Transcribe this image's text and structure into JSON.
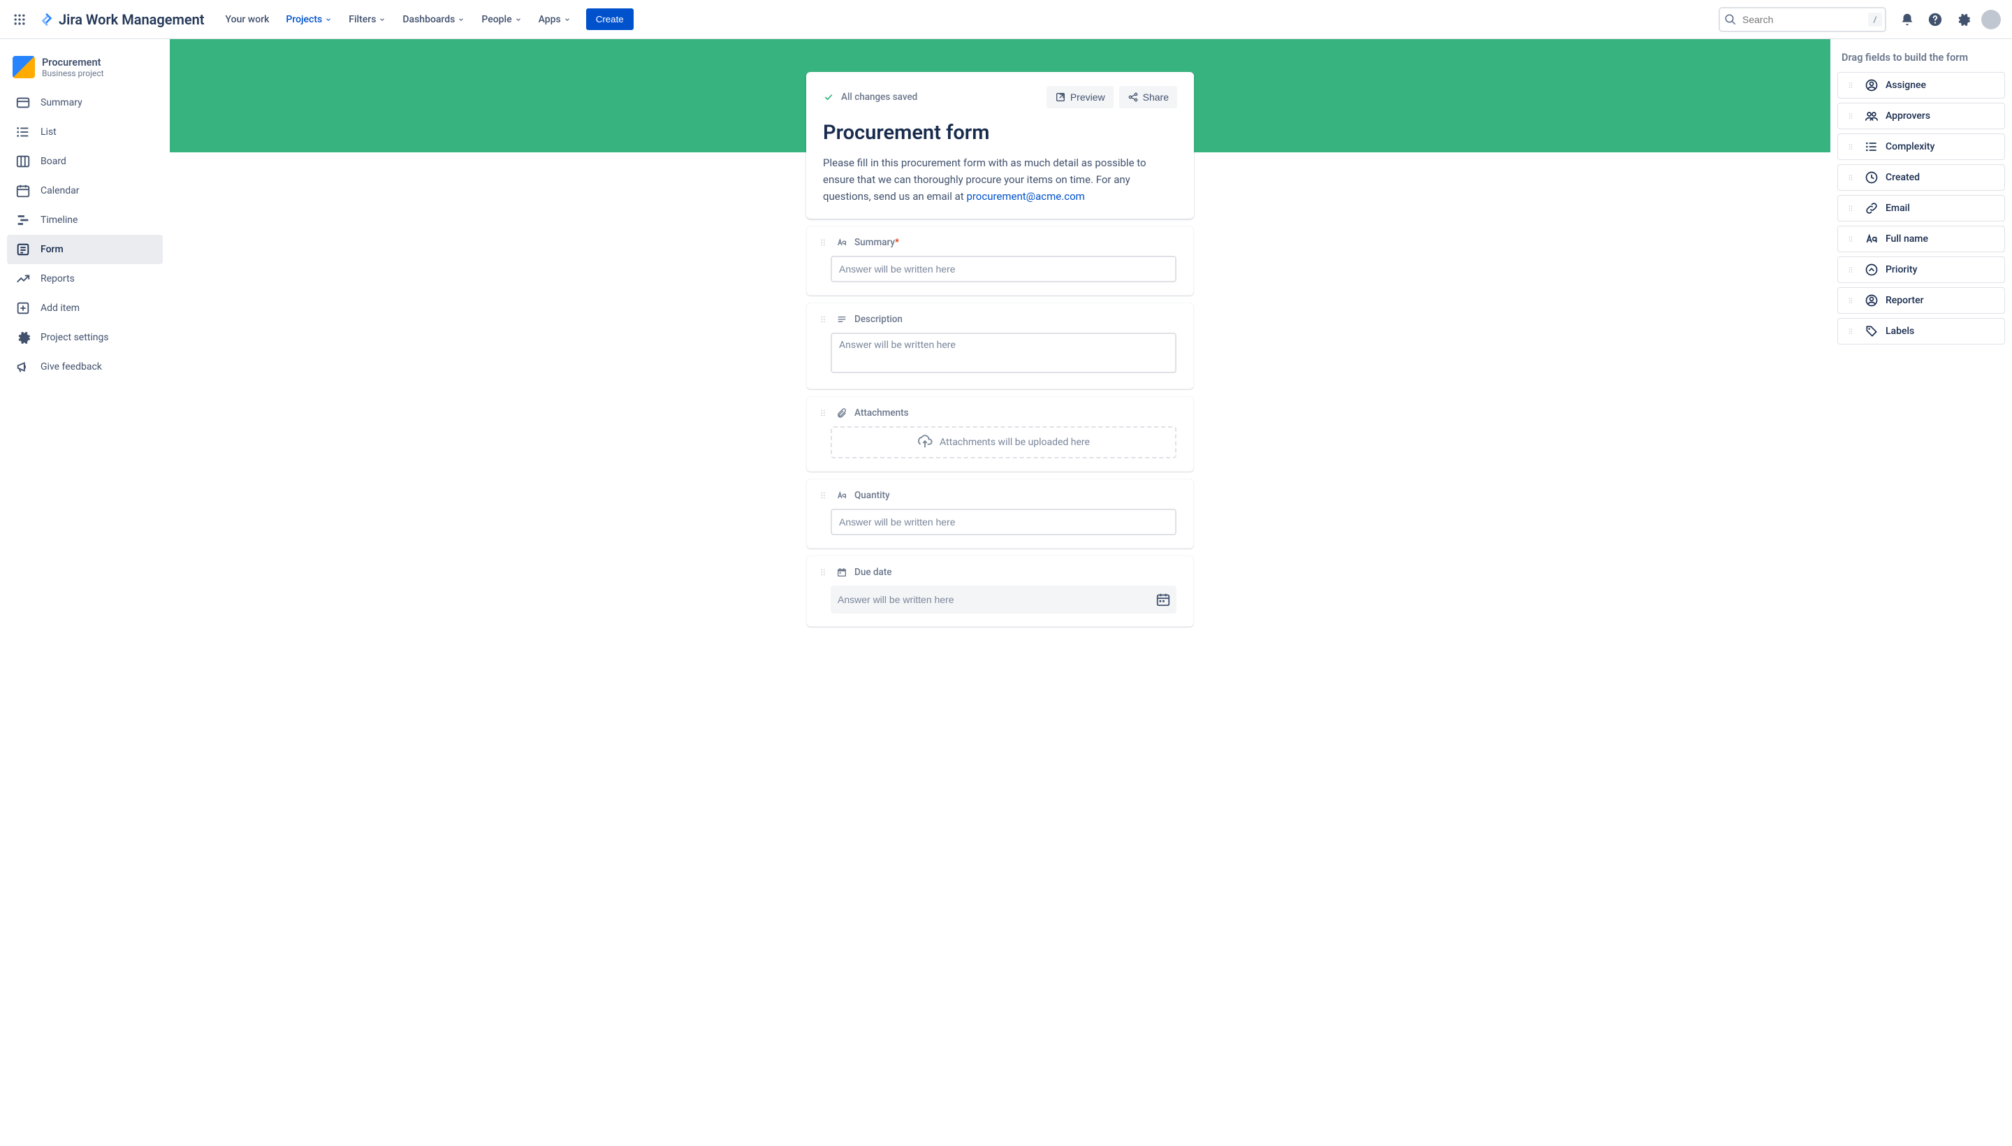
{
  "topnav": {
    "product": "Jira Work Management",
    "items": [
      {
        "label": "Your work",
        "dropdown": false,
        "active": false
      },
      {
        "label": "Projects",
        "dropdown": true,
        "active": true
      },
      {
        "label": "Filters",
        "dropdown": true,
        "active": false
      },
      {
        "label": "Dashboards",
        "dropdown": true,
        "active": false
      },
      {
        "label": "People",
        "dropdown": true,
        "active": false
      },
      {
        "label": "Apps",
        "dropdown": true,
        "active": false
      }
    ],
    "create": "Create",
    "search_placeholder": "Search",
    "slash": "/"
  },
  "project": {
    "name": "Procurement",
    "type": "Business project"
  },
  "sidebar": [
    {
      "icon": "summary",
      "label": "Summary"
    },
    {
      "icon": "list",
      "label": "List"
    },
    {
      "icon": "board",
      "label": "Board"
    },
    {
      "icon": "calendar",
      "label": "Calendar"
    },
    {
      "icon": "timeline",
      "label": "Timeline"
    },
    {
      "icon": "form",
      "label": "Form",
      "selected": true
    },
    {
      "icon": "reports",
      "label": "Reports"
    },
    {
      "icon": "additem",
      "label": "Add item"
    },
    {
      "icon": "settings",
      "label": "Project settings"
    },
    {
      "icon": "feedback",
      "label": "Give feedback"
    }
  ],
  "form": {
    "save_status": "All changes saved",
    "preview": "Preview",
    "share": "Share",
    "title": "Procurement form",
    "description_pre": "Please fill in this procurement form with as much detail as possible to ensure that we can thoroughly procure your items on time. For any questions, send us an email at ",
    "description_email": "procurement@acme.com",
    "placeholder": "Answer will be written here",
    "attach_placeholder": "Attachments will be uploaded here",
    "fields": [
      {
        "icon": "text",
        "label": "Summary",
        "required": true,
        "type": "input"
      },
      {
        "icon": "desc",
        "label": "Description",
        "type": "textarea"
      },
      {
        "icon": "attach",
        "label": "Attachments",
        "type": "dropzone"
      },
      {
        "icon": "text",
        "label": "Quantity",
        "type": "input"
      },
      {
        "icon": "date",
        "label": "Due date",
        "type": "date"
      }
    ]
  },
  "rightpanel": {
    "title": "Drag fields to build the form",
    "items": [
      {
        "icon": "person",
        "label": "Assignee"
      },
      {
        "icon": "people",
        "label": "Approvers"
      },
      {
        "icon": "list",
        "label": "Complexity"
      },
      {
        "icon": "clock",
        "label": "Created"
      },
      {
        "icon": "link",
        "label": "Email"
      },
      {
        "icon": "text",
        "label": "Full name"
      },
      {
        "icon": "priority",
        "label": "Priority"
      },
      {
        "icon": "person",
        "label": "Reporter"
      },
      {
        "icon": "tag",
        "label": "Labels"
      }
    ]
  }
}
